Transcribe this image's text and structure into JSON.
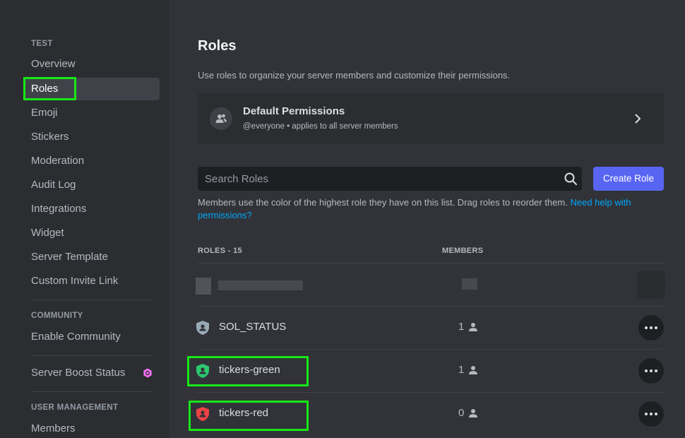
{
  "sidebar": {
    "sections": [
      {
        "header": "TEST"
      },
      {
        "header": "COMMUNITY"
      },
      {
        "header": "USER MANAGEMENT"
      }
    ],
    "items": [
      {
        "label": "Overview"
      },
      {
        "label": "Roles"
      },
      {
        "label": "Emoji"
      },
      {
        "label": "Stickers"
      },
      {
        "label": "Moderation"
      },
      {
        "label": "Audit Log"
      },
      {
        "label": "Integrations"
      },
      {
        "label": "Widget"
      },
      {
        "label": "Server Template"
      },
      {
        "label": "Custom Invite Link"
      },
      {
        "label": "Enable Community"
      },
      {
        "label": "Server Boost Status"
      },
      {
        "label": "Members"
      }
    ],
    "boost_icon": "nitro-gem-icon",
    "boost_color": "#ff73fa"
  },
  "main": {
    "title": "Roles",
    "subtitle": "Use roles to organize your server members and customize their permissions.",
    "default_permissions": {
      "title": "Default Permissions",
      "subtitle": "@everyone • applies to all server members",
      "icon": "people-icon"
    },
    "search": {
      "placeholder": "Search Roles",
      "value": ""
    },
    "create_button": "Create Role",
    "hint": "Members use the color of the highest role they have on this list. Drag roles to reorder them. ",
    "hint_link": "Need help with permissions?",
    "table": {
      "col_roles": "ROLES - 15",
      "col_members": "MEMBERS"
    },
    "roles": [
      {
        "name": "SOL_STATUS",
        "members": "1",
        "color": "#99aab5"
      },
      {
        "name": "tickers-green",
        "members": "1",
        "color": "#2dc770"
      },
      {
        "name": "tickers-red",
        "members": "0",
        "color": "#ed4245"
      }
    ],
    "accent_color": "#5865f2",
    "highlight_color": "#17e817"
  }
}
